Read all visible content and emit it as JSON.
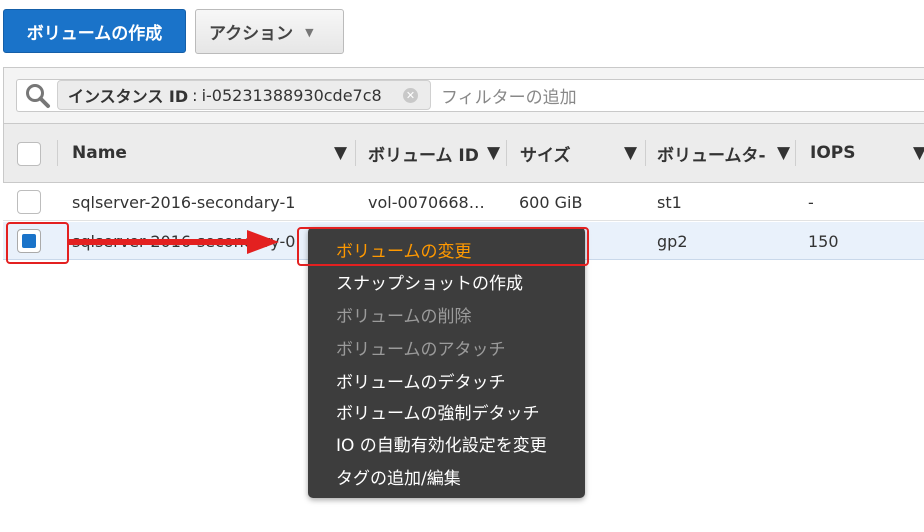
{
  "toolbar": {
    "create_volume_label": "ボリュームの作成",
    "actions_label": "アクション"
  },
  "search": {
    "token_key": "インスタンス ID",
    "token_sep": ":",
    "token_value": "i-05231388930cde7c8",
    "placeholder": "フィルターの追加"
  },
  "table": {
    "columns": [
      "Name",
      "ボリューム ID",
      "サイズ",
      "ボリュームタ-",
      "IOPS"
    ],
    "rows": [
      {
        "name": "sqlserver-2016-secondary-1",
        "volume_id": "vol-0070668…",
        "size": "600 GiB",
        "type": "st1",
        "iops": "-",
        "checked": false
      },
      {
        "name": "sqlserver-2016-secondary-0",
        "volume_id": "",
        "size": "",
        "type": "gp2",
        "iops": "150",
        "checked": true
      }
    ]
  },
  "context_menu": {
    "items": [
      {
        "label": "ボリュームの変更",
        "state": "highlighted"
      },
      {
        "label": "スナップショットの作成",
        "state": "enabled"
      },
      {
        "label": "ボリュームの削除",
        "state": "disabled"
      },
      {
        "label": "ボリュームのアタッチ",
        "state": "disabled"
      },
      {
        "label": "ボリュームのデタッチ",
        "state": "enabled"
      },
      {
        "label": "ボリュームの強制デタッチ",
        "state": "enabled"
      },
      {
        "label": "IO の自動有効化設定を変更",
        "state": "enabled"
      },
      {
        "label": "タグの追加/編集",
        "state": "enabled"
      }
    ]
  },
  "colors": {
    "primary": "#1a73c9",
    "menu_bg": "#3d3d3d",
    "menu_active": "#ff9900",
    "annotation": "#e32020"
  }
}
